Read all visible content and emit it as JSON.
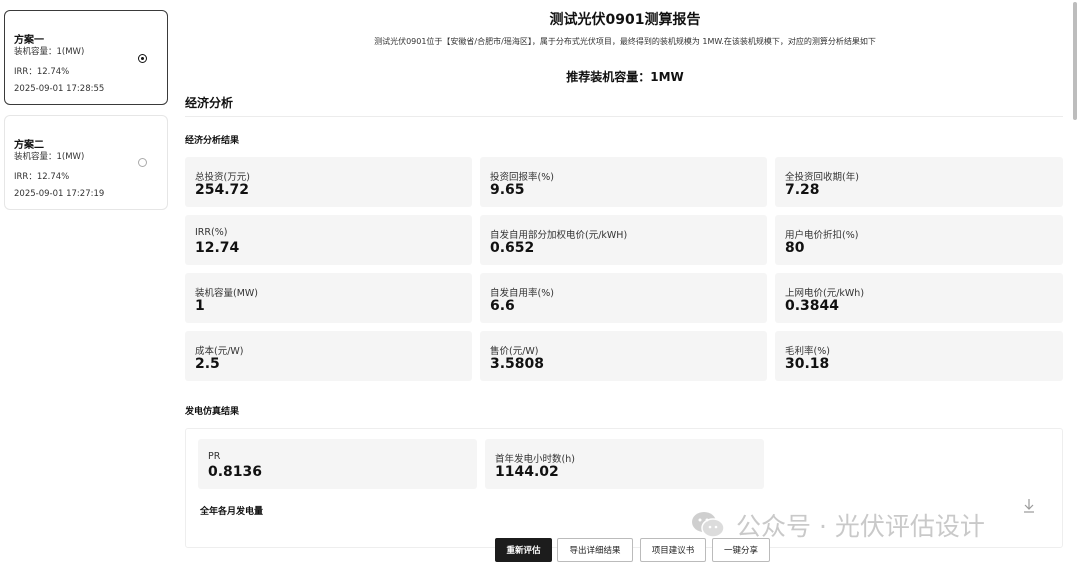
{
  "sidebar": {
    "plans": [
      {
        "name": "方案一",
        "capacity": "装机容量：1(MW)",
        "irr": "IRR：12.74%",
        "time": "2025-09-01 17:28:55",
        "selected": true
      },
      {
        "name": "方案二",
        "capacity": "装机容量：1(MW)",
        "irr": "IRR：12.74%",
        "time": "2025-09-01 17:27:19",
        "selected": false
      }
    ]
  },
  "report": {
    "title": "测试光伏0901测算报告",
    "subtitle": "测试光伏0901位于【安徽省/合肥市/瑶海区】，属于分布式光伏项目，最终得到的装机规模为 1MW.在该装机规模下，对应的测算分析结果如下",
    "recommended": "推荐装机容量：1MW",
    "section": "经济分析",
    "economic_heading": "经济分析结果",
    "generation_heading": "发电仿真结果",
    "monthly_heading": "全年各月发电量"
  },
  "economic": {
    "metrics": [
      {
        "label": "总投资(万元)",
        "value": "254.72"
      },
      {
        "label": "投资回报率(%)",
        "value": "9.65"
      },
      {
        "label": "全投资回收期(年)",
        "value": "7.28"
      },
      {
        "label": "IRR(%)",
        "value": "12.74"
      },
      {
        "label": "自发自用部分加权电价(元/kWH)",
        "value": "0.652"
      },
      {
        "label": "用户电价折扣(%)",
        "value": "80"
      },
      {
        "label": "装机容量(MW)",
        "value": "1"
      },
      {
        "label": "自发自用率(%)",
        "value": "6.6"
      },
      {
        "label": "上网电价(元/kWh)",
        "value": "0.3844"
      },
      {
        "label": "成本(元/W)",
        "value": "2.5"
      },
      {
        "label": "售价(元/W)",
        "value": "3.5808"
      },
      {
        "label": "毛利率(%)",
        "value": "30.18"
      }
    ]
  },
  "generation": {
    "metrics": [
      {
        "label": "PR",
        "value": "0.8136"
      },
      {
        "label": "首年发电小时数(h)",
        "value": "1144.02"
      }
    ]
  },
  "actions": {
    "reevaluate": "重新评估",
    "export": "导出详细结果",
    "proposal": "项目建议书",
    "share": "一键分享"
  },
  "watermark": {
    "text": "公众号 · 光伏评估设计",
    "icon": "wechat-icon"
  },
  "colors": {
    "primary_button": "#1c1c1c",
    "card_bg": "#f5f5f5",
    "watermark": "#c9c9c9"
  }
}
